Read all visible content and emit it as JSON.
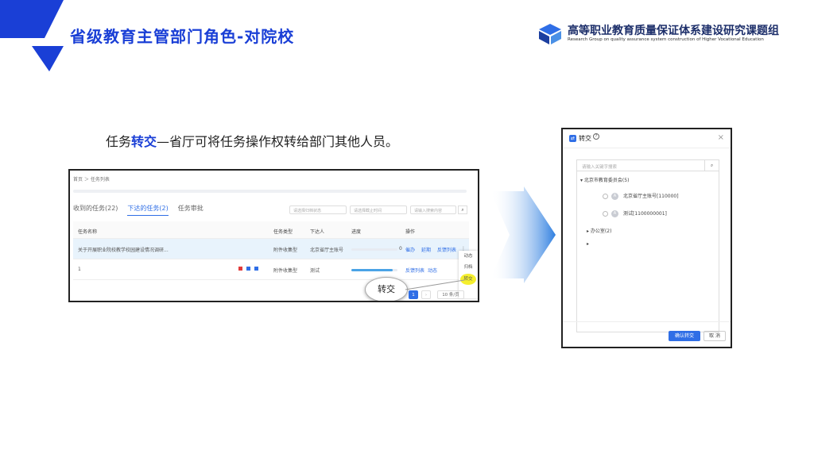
{
  "slide": {
    "title": "省级教育主管部门角色-对院校",
    "logo_cn": "高等职业教育质量保证体系建设研究课题组",
    "logo_en": "Research Group on quality assurance system construction of Higher Vocational Education",
    "subtitle_pre": "任务",
    "subtitle_highlight": "转交",
    "subtitle_post": "—省厅可将任务操作权转给部门其他人员。"
  },
  "colors": {
    "brand_blue": "#1a3fd6",
    "accent_blue": "#2f6ee6",
    "highlight_yellow": "#f5ef2e"
  },
  "task_page": {
    "breadcrumb": "首页 ＞ 任务列表",
    "tabs": [
      "收到的任务(22)",
      "下达的任务(2)",
      "任务审批"
    ],
    "active_tab": "下达的任务(2)",
    "filters": {
      "status_placeholder": "请选择归档状态",
      "date_placeholder": "请选择截止时间",
      "keyword_placeholder": "请输入搜索内容"
    },
    "columns": [
      "任务名称",
      "任务类型",
      "下达人",
      "进度",
      "操作"
    ],
    "rows": [
      {
        "name": "关于开展职业院校教学校园建设情况调研...",
        "type": "附件收集型",
        "issuer": "北京省厅主账号",
        "progress": 0.0,
        "progress_label": "0",
        "actions": [
          "催办",
          "延期",
          "反馈列表"
        ],
        "more": "⋮"
      },
      {
        "name": "1",
        "type": "附件收集型",
        "issuer": "测试",
        "progress": 0.9,
        "actions": [
          "反馈列表",
          "动态"
        ]
      }
    ],
    "dropdown_menu": [
      "动态",
      "归档",
      "转交"
    ],
    "magnified_label": "转交",
    "pagination": {
      "current": "1",
      "next": "›",
      "page_size": "10 条/页"
    }
  },
  "dialog": {
    "title": "转交",
    "close": "×",
    "search_placeholder": "请输入关键字搜索",
    "tree": {
      "root": "北京市教育委员会(5)",
      "users": [
        {
          "name": "北京省厅主账号[110000]",
          "avatar": "A"
        },
        {
          "name": "测试[1100000001]",
          "avatar": "A"
        }
      ],
      "group": "办公室(2)"
    },
    "confirm_label": "确认转交",
    "cancel_label": "取 消"
  }
}
